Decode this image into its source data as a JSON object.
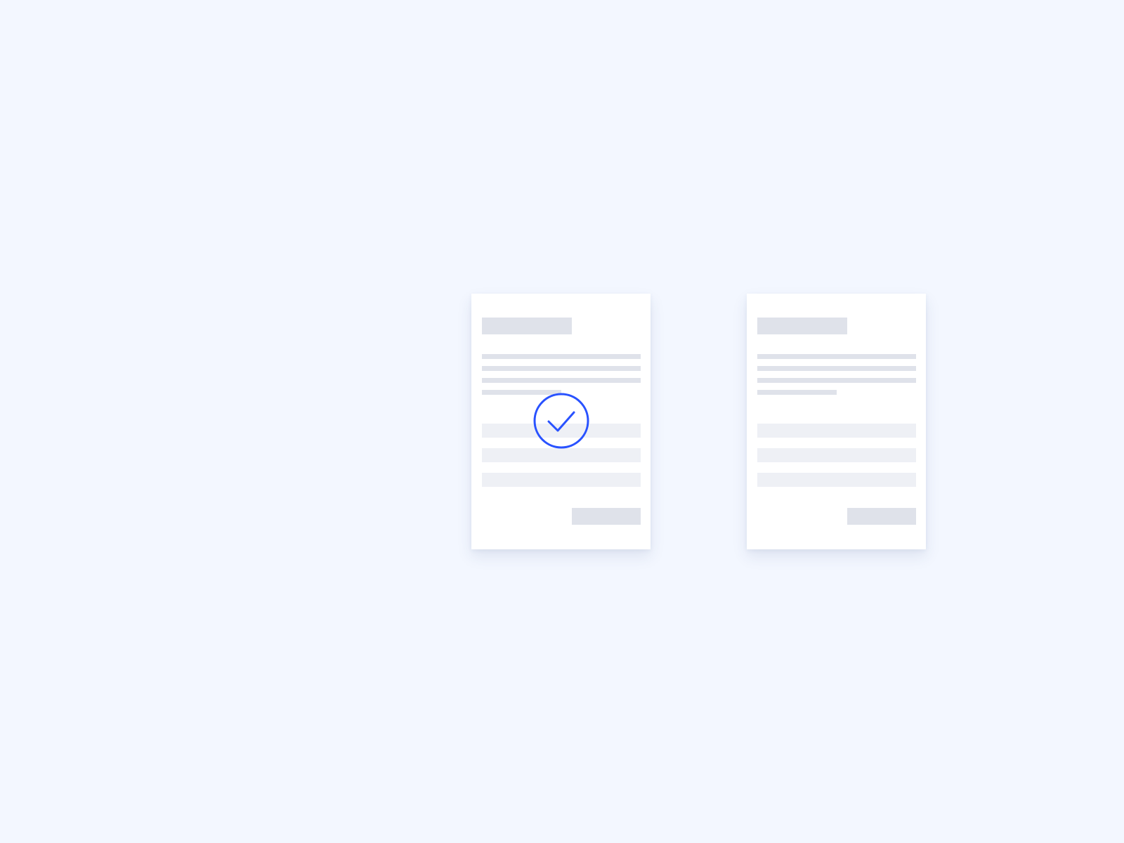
{
  "theme": {
    "background": "#f3f7ff",
    "card": "#ffffff",
    "skeleton": "#dfe2ea",
    "skeleton_field": "#eef0f5",
    "accent": "#2952ff"
  },
  "documents": [
    {
      "id": "left",
      "selected": true
    },
    {
      "id": "right",
      "selected": false
    }
  ],
  "icons": {
    "selection": "check-circle-icon"
  }
}
